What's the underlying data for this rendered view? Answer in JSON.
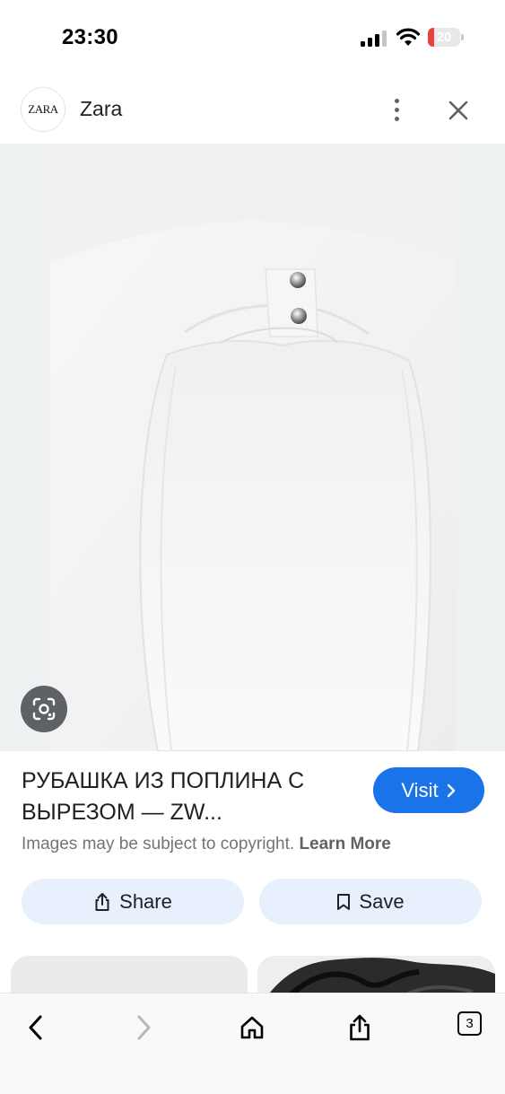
{
  "status_bar": {
    "time": "23:30",
    "battery_level": "20",
    "icons": [
      "signal-icon",
      "wifi-icon",
      "battery-icon"
    ]
  },
  "site": {
    "logo_text": "ZARA",
    "name": "Zara"
  },
  "product": {
    "title": "РУБАШКА ИЗ ПОПЛИНА С ВЫРЕЗОМ — ZW...",
    "visit_label": "Visit"
  },
  "copyright": {
    "text": "Images may be subject to copyright.",
    "link": "Learn More"
  },
  "actions": {
    "share_label": "Share",
    "save_label": "Save"
  },
  "toolbar": {
    "tab_count": "3",
    "icons": [
      "back-arrow-icon",
      "forward-arrow-icon",
      "home-icon",
      "share-icon",
      "tabs-icon"
    ]
  },
  "colors": {
    "accent": "#1a73e8",
    "action_button_bg": "#e8f0fe",
    "battery_low": "#e2453c"
  }
}
